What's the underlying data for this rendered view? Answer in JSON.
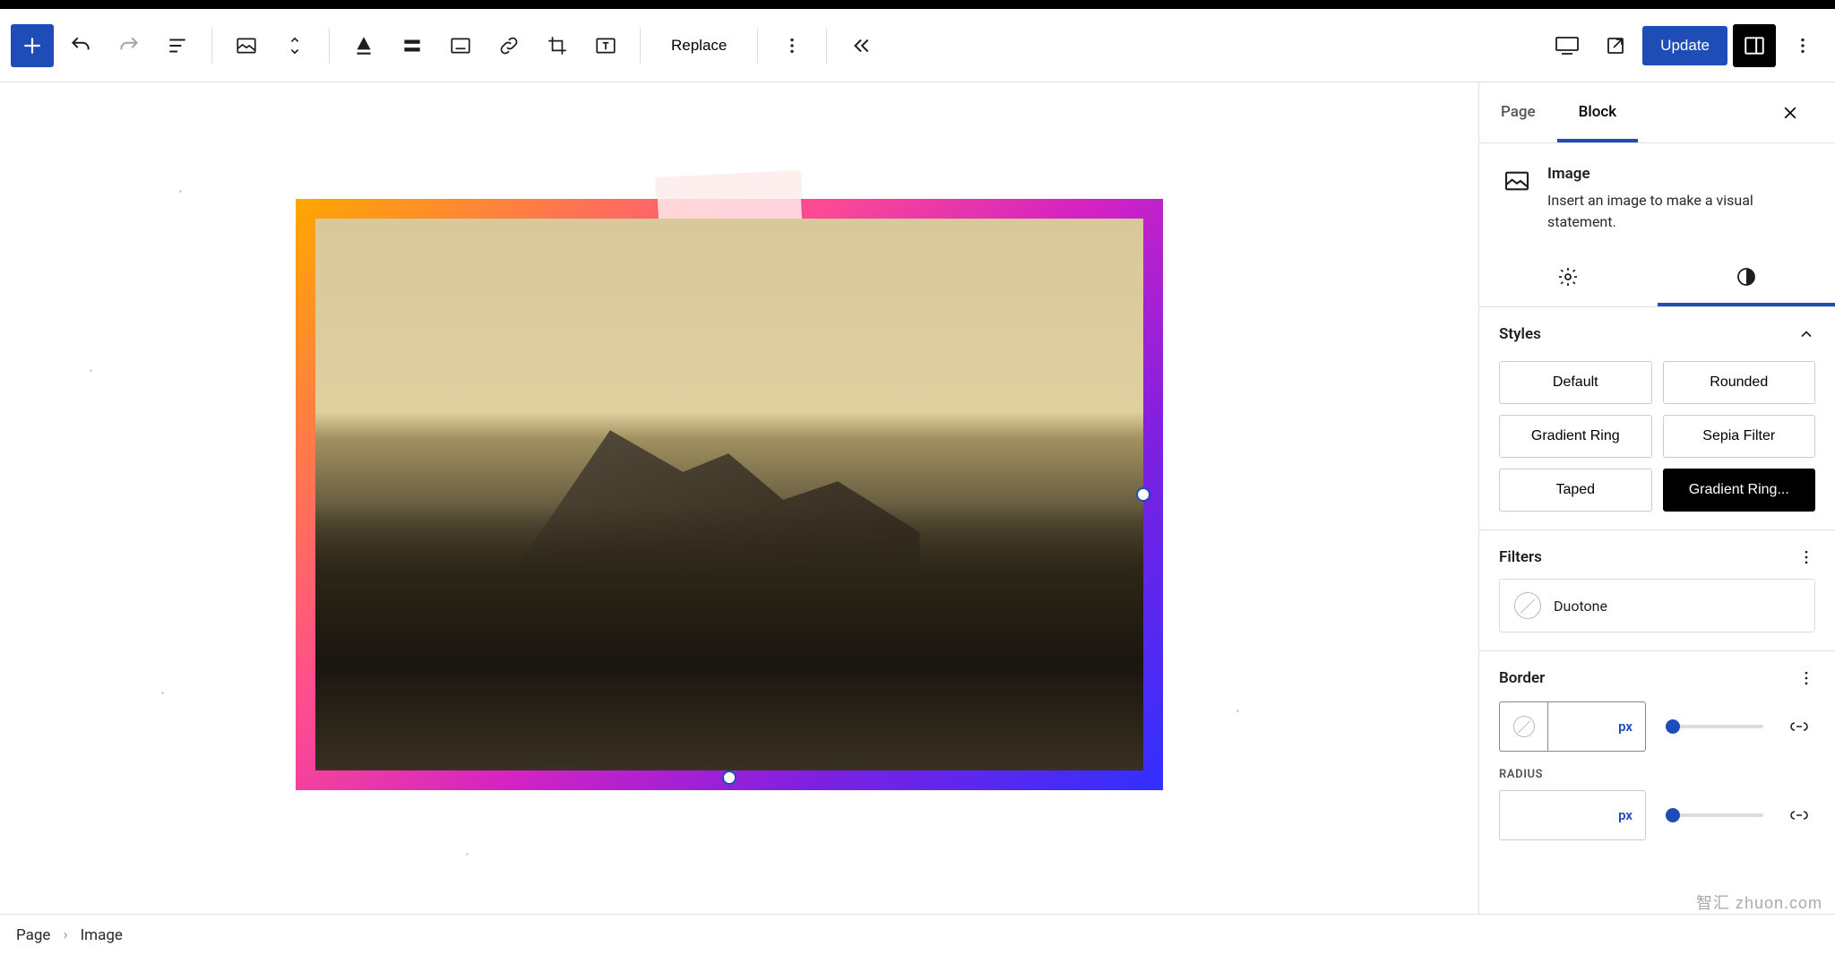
{
  "toolbar": {
    "replace_label": "Replace",
    "update_label": "Update"
  },
  "sidebar": {
    "tabs": {
      "page": "Page",
      "block": "Block"
    },
    "block_header": {
      "title": "Image",
      "description": "Insert an image to make a visual statement."
    },
    "styles": {
      "heading": "Styles",
      "options": [
        "Default",
        "Rounded",
        "Gradient Ring",
        "Sepia Filter",
        "Taped",
        "Gradient Ring..."
      ],
      "selected_index": 5
    },
    "filters": {
      "heading": "Filters",
      "duotone_label": "Duotone"
    },
    "border": {
      "heading": "Border",
      "unit": "px",
      "radius_label": "RADIUS",
      "radius_unit": "px"
    }
  },
  "breadcrumb": {
    "root": "Page",
    "current": "Image"
  },
  "watermark": "智汇 zhuon.com"
}
